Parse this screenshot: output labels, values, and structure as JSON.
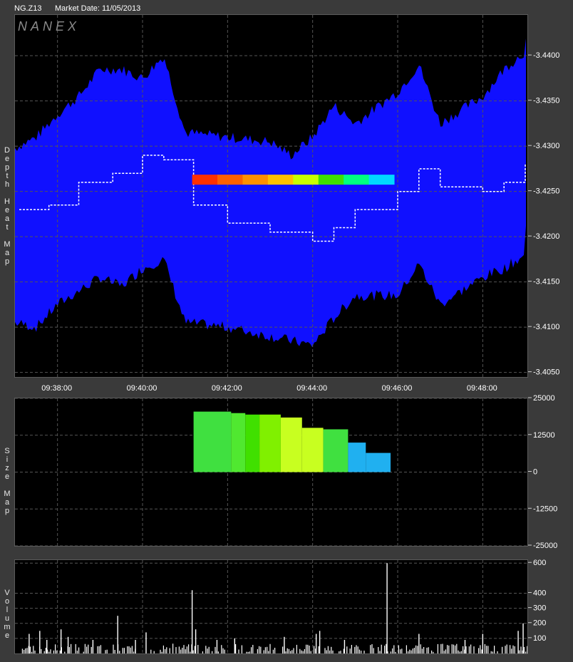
{
  "header": {
    "symbol": "NG.Z13",
    "market_date": "Market Date: 11/05/2013",
    "watermark": "NANEX"
  },
  "side_labels": {
    "depth": [
      "D",
      "e",
      "p",
      "t",
      "h",
      "",
      "H",
      "e",
      "a",
      "t",
      "",
      "M",
      "a",
      "p"
    ],
    "size": [
      "S",
      "i",
      "z",
      "e",
      "",
      "M",
      "a",
      "p"
    ],
    "volume": [
      "V",
      "o",
      "l",
      "u",
      "m",
      "e"
    ]
  },
  "colors": {
    "book": "#1010ff",
    "background": "#000000",
    "grid": "#555555",
    "volume": "#ffffff"
  },
  "chart_data": [
    {
      "type": "heatmap",
      "title": "Depth Heat Map",
      "x_ticks": [
        "09:38:00",
        "09:40:00",
        "09:42:00",
        "09:44:00",
        "09:46:00",
        "09:48:00"
      ],
      "x_range": [
        "09:37:00",
        "09:49:03"
      ],
      "y_ticks": [
        "3.4050",
        "3.4100",
        "3.4150",
        "3.4200",
        "3.4250",
        "3.4300",
        "3.4350",
        "3.4400"
      ],
      "ylim": [
        3.4045,
        3.4445
      ],
      "ask_edge": [
        [
          0,
          3.4298
        ],
        [
          0.5,
          3.431
        ],
        [
          1.0,
          3.4335
        ],
        [
          1.5,
          3.4355
        ],
        [
          2.0,
          3.4385
        ],
        [
          2.5,
          3.4385
        ],
        [
          3.0,
          3.4375
        ],
        [
          3.5,
          3.44
        ],
        [
          4.0,
          3.4315
        ],
        [
          5.0,
          3.431
        ],
        [
          6.0,
          3.4305
        ],
        [
          6.5,
          3.429
        ],
        [
          7.0,
          3.431
        ],
        [
          7.5,
          3.4345
        ],
        [
          8.0,
          3.4325
        ],
        [
          9.0,
          3.436
        ],
        [
          9.5,
          3.439
        ],
        [
          10.0,
          3.4325
        ],
        [
          11.0,
          3.4355
        ],
        [
          11.5,
          3.4385
        ],
        [
          12.0,
          3.4405
        ],
        [
          12.05,
          3.444
        ]
      ],
      "bid_edge": [
        [
          0,
          3.4105
        ],
        [
          0.5,
          3.41
        ],
        [
          1.0,
          3.4125
        ],
        [
          1.5,
          3.414
        ],
        [
          2.0,
          3.4155
        ],
        [
          2.5,
          3.4145
        ],
        [
          3.0,
          3.4165
        ],
        [
          3.5,
          3.4175
        ],
        [
          4.0,
          3.4105
        ],
        [
          5.0,
          3.41
        ],
        [
          6.0,
          3.409
        ],
        [
          7.0,
          3.408
        ],
        [
          7.5,
          3.411
        ],
        [
          8.0,
          3.4135
        ],
        [
          9.0,
          3.4135
        ],
        [
          9.5,
          3.417
        ],
        [
          10.0,
          3.4125
        ],
        [
          11.0,
          3.4155
        ],
        [
          11.5,
          3.4165
        ],
        [
          12.0,
          3.418
        ],
        [
          12.05,
          3.427
        ]
      ],
      "big_order": {
        "price": 3.4263,
        "start": "09:41:10",
        "end": "09:45:55",
        "colors": [
          "#ff3000",
          "#ff6000",
          "#ff9000",
          "#ffc000",
          "#c8ff00",
          "#40e000",
          "#00ff80",
          "#00d8ff"
        ]
      },
      "trade_path": [
        [
          0.1,
          3.423
        ],
        [
          0.8,
          3.4235
        ],
        [
          1.5,
          3.426
        ],
        [
          2.3,
          3.427
        ],
        [
          3.0,
          3.429
        ],
        [
          3.5,
          3.4285
        ],
        [
          4.2,
          3.4235
        ],
        [
          5.0,
          3.4215
        ],
        [
          6.0,
          3.4205
        ],
        [
          7.0,
          3.4195
        ],
        [
          7.5,
          3.421
        ],
        [
          8.0,
          3.423
        ],
        [
          9.0,
          3.425
        ],
        [
          9.5,
          3.4275
        ],
        [
          10.0,
          3.4255
        ],
        [
          11.0,
          3.425
        ],
        [
          11.5,
          3.426
        ],
        [
          12.0,
          3.428
        ]
      ]
    },
    {
      "type": "bar",
      "title": "Size Map",
      "y_ticks": [
        "25000",
        "12500",
        "0",
        "-12500",
        "-25000"
      ],
      "ylim": [
        -25000,
        25000
      ],
      "segments": [
        {
          "start": "09:41:12",
          "end": "09:42:05",
          "value": 20500,
          "color": "#40e040"
        },
        {
          "start": "09:42:05",
          "end": "09:42:25",
          "value": 20000,
          "color": "#50e830"
        },
        {
          "start": "09:42:25",
          "end": "09:42:45",
          "value": 19500,
          "color": "#40e000"
        },
        {
          "start": "09:42:45",
          "end": "09:43:15",
          "value": 19500,
          "color": "#80f000"
        },
        {
          "start": "09:43:15",
          "end": "09:43:45",
          "value": 18500,
          "color": "#c8ff20"
        },
        {
          "start": "09:43:45",
          "end": "09:44:15",
          "value": 15000,
          "color": "#c8ff20"
        },
        {
          "start": "09:44:15",
          "end": "09:44:50",
          "value": 14500,
          "color": "#40e040"
        },
        {
          "start": "09:44:50",
          "end": "09:45:15",
          "value": 10000,
          "color": "#20b0f0"
        },
        {
          "start": "09:45:15",
          "end": "09:45:50",
          "value": 6500,
          "color": "#20b0f0"
        }
      ]
    },
    {
      "type": "bar",
      "title": "Volume",
      "y_ticks": [
        "600",
        "400",
        "300",
        "200",
        "100"
      ],
      "ylim": [
        0,
        620
      ],
      "spikes": [
        [
          "09:37:20",
          130
        ],
        [
          "09:37:35",
          150
        ],
        [
          "09:37:45",
          90
        ],
        [
          "09:38:05",
          160
        ],
        [
          "09:38:15",
          110
        ],
        [
          "09:38:50",
          90
        ],
        [
          "09:39:25",
          250
        ],
        [
          "09:39:50",
          90
        ],
        [
          "09:40:05",
          140
        ],
        [
          "09:41:10",
          420
        ],
        [
          "09:41:15",
          160
        ],
        [
          "09:41:45",
          90
        ],
        [
          "09:42:10",
          100
        ],
        [
          "09:43:20",
          110
        ],
        [
          "09:44:05",
          130
        ],
        [
          "09:44:10",
          150
        ],
        [
          "09:44:45",
          90
        ],
        [
          "09:45:45",
          600
        ],
        [
          "09:46:30",
          130
        ],
        [
          "09:47:35",
          90
        ],
        [
          "09:48:00",
          130
        ],
        [
          "09:48:50",
          150
        ],
        [
          "09:48:57",
          200
        ]
      ]
    }
  ]
}
